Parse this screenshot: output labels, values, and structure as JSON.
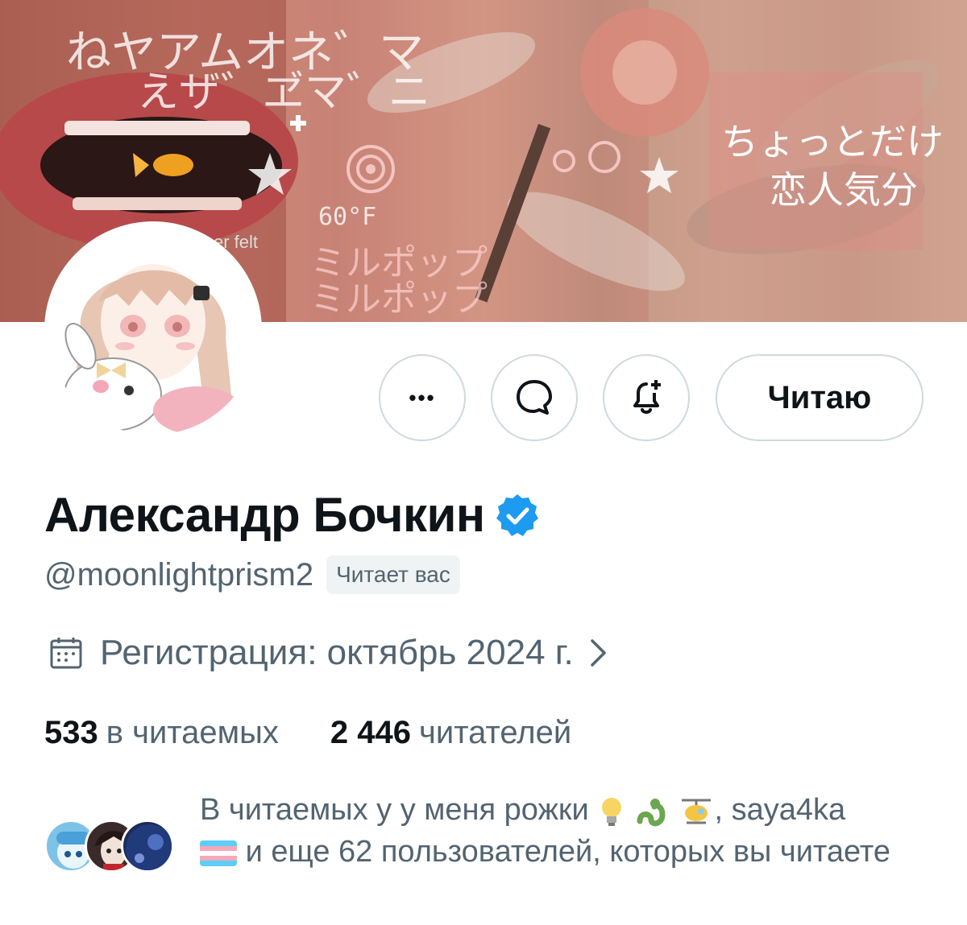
{
  "banner": {
    "jp_line1": "ねヤアムオネ゛マ",
    "jp_line2": "えザ゛ヹマ゛ニ",
    "jp_right1": "ちょっとだけ",
    "jp_right2": "恋人気分",
    "temp": "60°F",
    "katakana1": "ミルポップ",
    "katakana2": "ミルポップ",
    "felt_text": "er felt"
  },
  "actions": {
    "more_label": "•••",
    "follow_label": "Читаю"
  },
  "profile": {
    "name": "Александр Бочкин",
    "handle": "@moonlightprism2",
    "follows_you": "Читает вас",
    "joined": "Регистрация: октябрь 2024 г.",
    "following_count": "533",
    "following_label": "в читаемых",
    "followers_count": "2 446",
    "followers_label": "читателей"
  },
  "mutuals": {
    "prefix": "В читаемых у у меня рожки",
    "after_emoji": ", saya4ka",
    "suffix": "и еще 62 пользователей, которых вы читаете"
  },
  "colors": {
    "verified": "#1d9bf0",
    "text_primary": "#0f1419",
    "text_secondary": "#536471",
    "border": "#cfd9de"
  }
}
